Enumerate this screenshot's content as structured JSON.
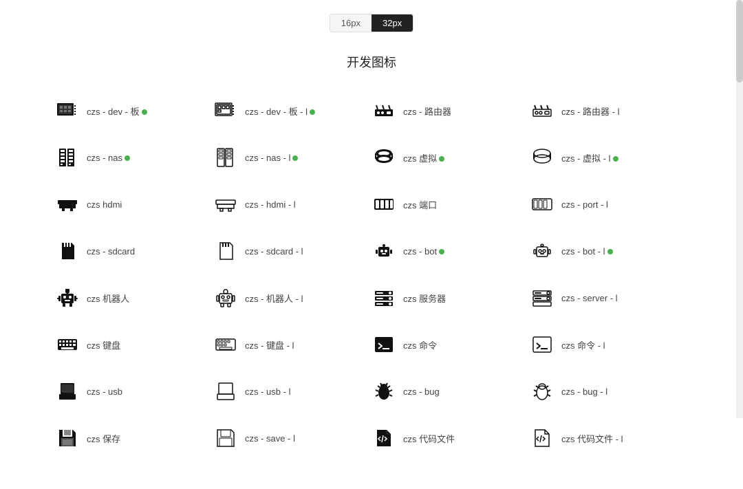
{
  "sizeOptions": [
    {
      "label": "16px",
      "active": false
    },
    {
      "label": "32px",
      "active": true
    }
  ],
  "sectionTitle": "开发图标",
  "icons": [
    {
      "id": "czs-dev",
      "label": "czs - dev - 板",
      "hasDot": true,
      "type": "dev-board"
    },
    {
      "id": "czs-dev-l",
      "label": "czs - dev - 板 - l",
      "hasDot": true,
      "type": "dev-board-l"
    },
    {
      "id": "czs-router",
      "label": "czs - 路由器",
      "hasDot": false,
      "type": "router"
    },
    {
      "id": "czs-router-l",
      "label": "czs - 路由器 - l",
      "hasDot": false,
      "type": "router-l"
    },
    {
      "id": "czs-nas",
      "label": "czs - nas",
      "hasDot": true,
      "type": "nas"
    },
    {
      "id": "czs-nas-l",
      "label": "czs - nas - l",
      "hasDot": true,
      "type": "nas-l"
    },
    {
      "id": "czs-virtual",
      "label": "czs 虚拟",
      "hasDot": true,
      "type": "virtual"
    },
    {
      "id": "czs-virtual-l",
      "label": "czs - 虚拟 - l",
      "hasDot": true,
      "type": "virtual-l"
    },
    {
      "id": "czs-hdmi",
      "label": "czs hdmi",
      "hasDot": false,
      "type": "hdmi"
    },
    {
      "id": "czs-hdmi-l",
      "label": "czs - hdmi - l",
      "hasDot": false,
      "type": "hdmi-l"
    },
    {
      "id": "czs-port",
      "label": "czs 端口",
      "hasDot": false,
      "type": "port"
    },
    {
      "id": "czs-port-l",
      "label": "czs - port - l",
      "hasDot": false,
      "type": "port-l"
    },
    {
      "id": "czs-sdcard",
      "label": "czs - sdcard",
      "hasDot": false,
      "type": "sdcard"
    },
    {
      "id": "czs-sdcard-l",
      "label": "czs - sdcard - l",
      "hasDot": false,
      "type": "sdcard-l"
    },
    {
      "id": "czs-bot",
      "label": "czs - bot",
      "hasDot": true,
      "type": "bot"
    },
    {
      "id": "czs-bot-l",
      "label": "czs - bot - l",
      "hasDot": true,
      "type": "bot-l"
    },
    {
      "id": "czs-robot",
      "label": "czs 机器人",
      "hasDot": false,
      "type": "robot"
    },
    {
      "id": "czs-robot-l",
      "label": "czs - 机器人 - l",
      "hasDot": false,
      "type": "robot-l"
    },
    {
      "id": "czs-server",
      "label": "czs 服务器",
      "hasDot": false,
      "type": "server"
    },
    {
      "id": "czs-server-l",
      "label": "czs - server - l",
      "hasDot": false,
      "type": "server-l"
    },
    {
      "id": "czs-keyboard",
      "label": "czs 键盘",
      "hasDot": false,
      "type": "keyboard"
    },
    {
      "id": "czs-keyboard-l",
      "label": "czs - 键盘 - l",
      "hasDot": false,
      "type": "keyboard-l"
    },
    {
      "id": "czs-cmd",
      "label": "czs 命令",
      "hasDot": false,
      "type": "cmd"
    },
    {
      "id": "czs-cmd-l",
      "label": "czs 命令 - l",
      "hasDot": false,
      "type": "cmd-l"
    },
    {
      "id": "czs-usb",
      "label": "czs - usb",
      "hasDot": false,
      "type": "usb"
    },
    {
      "id": "czs-usb-l",
      "label": "czs - usb - l",
      "hasDot": false,
      "type": "usb-l"
    },
    {
      "id": "czs-bug",
      "label": "czs - bug",
      "hasDot": false,
      "type": "bug"
    },
    {
      "id": "czs-bug-l",
      "label": "czs - bug - l",
      "hasDot": false,
      "type": "bug-l"
    },
    {
      "id": "czs-save",
      "label": "czs 保存",
      "hasDot": false,
      "type": "save"
    },
    {
      "id": "czs-save-l",
      "label": "czs - save - l",
      "hasDot": false,
      "type": "save-l"
    },
    {
      "id": "czs-codefile",
      "label": "czs 代码文件",
      "hasDot": false,
      "type": "codefile"
    },
    {
      "id": "czs-codefile-l",
      "label": "czs 代码文件 - l",
      "hasDot": false,
      "type": "codefile-l"
    }
  ]
}
